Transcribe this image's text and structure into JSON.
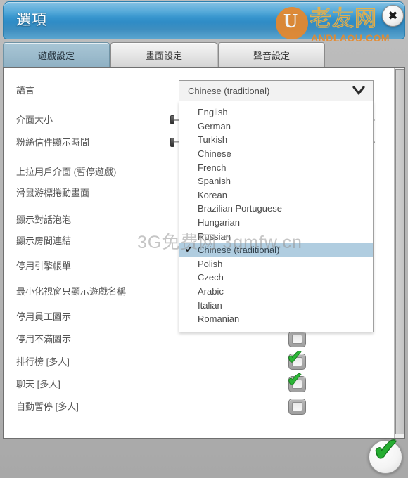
{
  "window": {
    "title": "選項",
    "close_icon": "close-icon"
  },
  "watermark": {
    "logo_letter": "U",
    "brand_cn": "老友网",
    "domain": "ANDLAOU.COM",
    "center_text": "3G免费网 3gmfw.cn",
    "brand_color": "#e8882c"
  },
  "tabs": [
    {
      "label": "遊戲設定",
      "active": true
    },
    {
      "label": "畫面設定",
      "active": false
    },
    {
      "label": "聲音設定",
      "active": false
    }
  ],
  "settings_rows": [
    {
      "label": "語言",
      "widget": "dropdown"
    },
    {
      "label": "介面大小",
      "widget": "slider"
    },
    {
      "label": "粉絲信件顯示時間",
      "widget": "slider"
    },
    {
      "label": "上拉用戶介面 (暫停遊戲)",
      "widget": "checkbox",
      "checked": false
    },
    {
      "label": "滑鼠游標捲動畫面",
      "widget": "checkbox",
      "checked": false
    },
    {
      "label": "顯示對話泡泡",
      "widget": "checkbox",
      "checked": false
    },
    {
      "label": "顯示房間連結",
      "widget": "checkbox",
      "checked": false
    },
    {
      "label": "停用引擎帳單",
      "widget": "checkbox",
      "checked": false
    },
    {
      "label": "最小化視窗只顯示遊戲名稱",
      "widget": "checkbox",
      "checked": false
    },
    {
      "label": "停用員工圖示",
      "widget": "checkbox",
      "checked": false
    },
    {
      "label": "停用不滿圖示",
      "widget": "checkbox",
      "checked": false
    },
    {
      "label": "排行榜 [多人]",
      "widget": "checkbox",
      "checked": true
    },
    {
      "label": "聊天 [多人]",
      "widget": "checkbox",
      "checked": true
    },
    {
      "label": "自動暫停 [多人]",
      "widget": "checkbox",
      "checked": false
    }
  ],
  "language_dropdown": {
    "selected": "Chinese (traditional)",
    "expanded": true,
    "chevron_icon": "chevron-down-icon",
    "check_glyph": "✔",
    "options": [
      "English",
      "German",
      "Turkish",
      "Chinese",
      "French",
      "Spanish",
      "Korean",
      "Brazilian Portuguese",
      "Hungarian",
      "Russian",
      "Chinese (traditional)",
      "Polish",
      "Czech",
      "Arabic",
      "Italian",
      "Romanian"
    ]
  },
  "footer": {
    "confirm_label": "✔",
    "confirm_icon": "check-icon"
  },
  "colors": {
    "titlebar_blue": "#3e9ed4",
    "tab_active": "#9dbccd",
    "check_green": "#2cb537",
    "panel_bg": "#ffffff"
  }
}
